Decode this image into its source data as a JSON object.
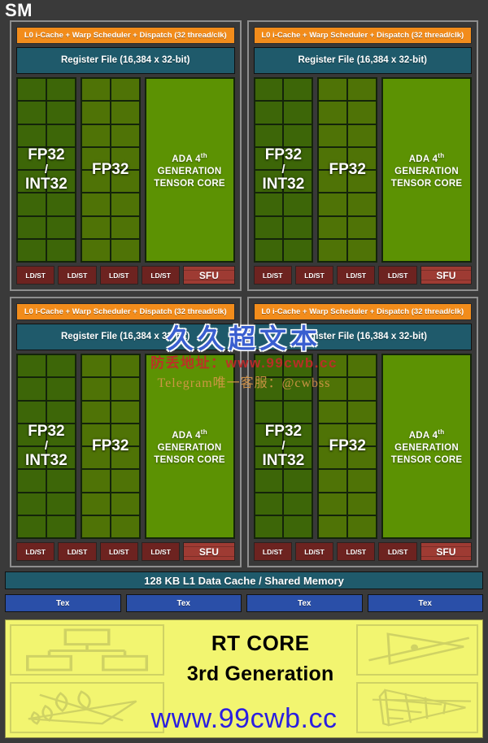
{
  "title": "SM",
  "quadrant": {
    "scheduler": "L0 i-Cache + Warp Scheduler + Dispatch (32 thread/clk)",
    "register_file": "Register File (16,384 x 32-bit)",
    "fp32_int32_label_line1": "FP32",
    "fp32_int32_label_slash": "/",
    "fp32_int32_label_line3": "INT32",
    "fp32_label": "FP32",
    "tensor_core_line1_pre": "ADA 4",
    "tensor_core_line1_sup": "th",
    "tensor_core_line2": "GENERATION",
    "tensor_core_line3": "TENSOR CORE",
    "ldst_label": "LD/ST",
    "sfu_label": "SFU",
    "ldst_count": 4,
    "fp32_int32_cells": 16,
    "fp32_cells": 16
  },
  "quadrants": [
    {
      "id": "sm-partition-0"
    },
    {
      "id": "sm-partition-1"
    },
    {
      "id": "sm-partition-2"
    },
    {
      "id": "sm-partition-3"
    }
  ],
  "l1_cache": "128 KB L1 Data Cache / Shared Memory",
  "tex_units": [
    {
      "label": "Tex"
    },
    {
      "label": "Tex"
    },
    {
      "label": "Tex"
    },
    {
      "label": "Tex"
    }
  ],
  "rt_core": {
    "line1": "RT CORE",
    "line2": "3rd Generation",
    "icons": [
      {
        "name": "bvh-tree-icon",
        "position": "top-left"
      },
      {
        "name": "foliage-alpha-test-icon",
        "position": "bottom-left"
      },
      {
        "name": "ray-triangle-intersection-icon",
        "position": "top-right"
      },
      {
        "name": "triangle-mesh-grid-icon",
        "position": "bottom-right"
      }
    ]
  },
  "watermarks": {
    "center_cn": "久久超文本",
    "red_line": "防丢地址：www.99cwb.cc",
    "telegram_line": "Telegram唯一客服：@cwbss",
    "bottom_url": "www.99cwb.cc"
  },
  "colors": {
    "background": "#3a3a3a",
    "scheduler_orange": "#f28c1b",
    "register_teal": "#1f5a6b",
    "fp32_int32_green": "#3d6608",
    "fp32_green": "#4f7306",
    "tensor_green": "#5c9203",
    "ldst_red": "#6d2320",
    "sfu_red": "#9e3b33",
    "tex_blue": "#2a4fa8",
    "rt_core_yellow": "#f2f570"
  }
}
